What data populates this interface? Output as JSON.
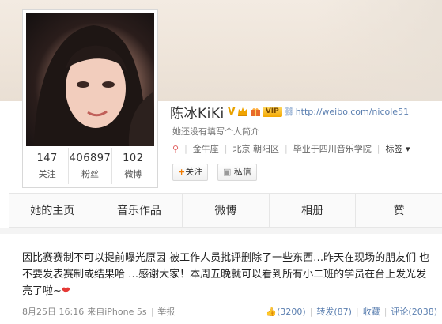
{
  "profile": {
    "name": "陈冰KiKi",
    "verified_badge": "V",
    "vip_label": "VIP",
    "url": "http://weibo.com/nicole51",
    "intro": "她还没有填写个人简介",
    "zodiac": "金牛座",
    "location": "北京 朝阳区",
    "school": "毕业于四川音乐学院",
    "tags_label": "标签",
    "stats": [
      {
        "num": "147",
        "label": "关注"
      },
      {
        "num": "406897",
        "label": "粉丝"
      },
      {
        "num": "102",
        "label": "微博"
      }
    ],
    "follow_label": "关注",
    "message_label": "私信"
  },
  "tabs": [
    "她的主页",
    "音乐作品",
    "微博",
    "相册",
    "赞"
  ],
  "post": {
    "text": "因比赛赛制不可以提前曝光原因 被工作人员批评删除了一些东西…昨天在现场的朋友们 也不要发表赛制或结果哈 …感谢大家！本周五晚就可以看到所有小二班的学员在台上发光发亮了啦~",
    "date": "8月25日 16:16",
    "source": "来自iPhone 5s",
    "report": "举报",
    "likes": "(3200)",
    "repost": "转发(87)",
    "favorite": "收藏",
    "comment": "评论(2038)"
  },
  "colors": {
    "link": "#5b7fb0",
    "accent_orange": "#f07a00",
    "heart": "#e53935"
  }
}
